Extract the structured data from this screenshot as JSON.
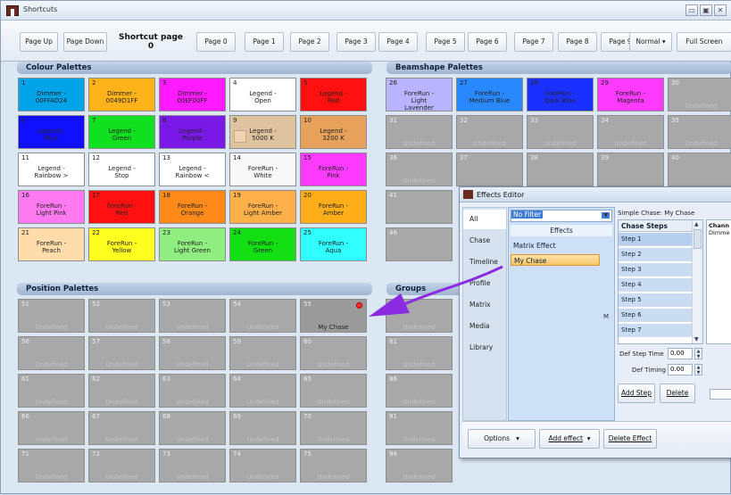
{
  "window": {
    "title": "Shortcuts"
  },
  "toolbar": {
    "page_up": "Page Up",
    "page_down": "Page Down",
    "shortcut_page": "Shortcut page 0",
    "pages": [
      "Page 0",
      "Page 1",
      "Page 2",
      "Page 3",
      "Page 4",
      "Page 5",
      "Page 6",
      "Page 7",
      "Page 8",
      "Page 9"
    ],
    "normal": "Normal",
    "full_screen": "Full Screen"
  },
  "panels": {
    "colour": "Colour Palettes",
    "beamshape": "Beamshape Palettes",
    "position": "Position Palettes",
    "groups": "Groups"
  },
  "colour_cells": [
    {
      "num": "1",
      "label": "Dimmer -\n00FFAD24",
      "color": "#00a2e8"
    },
    {
      "num": "2",
      "label": "Dimmer -\n0049D1FF",
      "color": "#ffb31a"
    },
    {
      "num": "3",
      "label": "Dimmer -\n00EF00FF",
      "color": "#ff1aff"
    },
    {
      "num": "4",
      "label": "Legend -\nOpen",
      "color": "#ffffff"
    },
    {
      "num": "5",
      "label": "Legend -\nRed",
      "color": "#ff1010"
    },
    {
      "num": "6",
      "label": "Legend -\nBlue",
      "color": "#1010ff"
    },
    {
      "num": "7",
      "label": "Legend -\nGreen",
      "color": "#10e020"
    },
    {
      "num": "8",
      "label": "Legend -\nPurple",
      "color": "#7a18e8"
    },
    {
      "num": "9",
      "label": "Legend -\n5000 K",
      "color": "#dfc39f"
    },
    {
      "num": "10",
      "label": "Legend -\n3200 K",
      "color": "#e6a15b"
    },
    {
      "num": "11",
      "label": "Legend -\nRainbow >",
      "color": "#ffffff"
    },
    {
      "num": "12",
      "label": "Legend -\nStop",
      "color": "#ffffff"
    },
    {
      "num": "13",
      "label": "Legend -\nRainbow <",
      "color": "#ffffff"
    },
    {
      "num": "14",
      "label": "ForeRun -\nWhite",
      "color": "#f8f8f8"
    },
    {
      "num": "15",
      "label": "ForeRun -\nPink",
      "color": "#ff3aff"
    },
    {
      "num": "16",
      "label": "ForeRun -\nLight Pink",
      "color": "#ff7af0"
    },
    {
      "num": "17",
      "label": "ForeRun -\nRed",
      "color": "#ff1010"
    },
    {
      "num": "18",
      "label": "ForeRun -\nOrange",
      "color": "#ff8a1a"
    },
    {
      "num": "19",
      "label": "ForeRun -\nLight Amber",
      "color": "#ffb04a"
    },
    {
      "num": "20",
      "label": "ForeRun -\nAmber",
      "color": "#ffae1a"
    },
    {
      "num": "21",
      "label": "ForeRun -\nPeach",
      "color": "#ffdcaa"
    },
    {
      "num": "22",
      "label": "ForeRun -\nYellow",
      "color": "#ffff20"
    },
    {
      "num": "23",
      "label": "ForeRun -\nLight Green",
      "color": "#90ee80"
    },
    {
      "num": "24",
      "label": "ForeRun -\nGreen",
      "color": "#12e012"
    },
    {
      "num": "25",
      "label": "ForeRun -\nAqua",
      "color": "#30ffff"
    }
  ],
  "beam_cells": [
    {
      "num": "26",
      "label": "ForeRun -\nLight\nLavender",
      "color": "#b8b4ff"
    },
    {
      "num": "27",
      "label": "ForeRun -\nMedium Blue",
      "color": "#2a88ff"
    },
    {
      "num": "28",
      "label": "ForeRun -\nDark Blue",
      "color": "#1a30ff"
    },
    {
      "num": "29",
      "label": "ForeRun -\nMagenta",
      "color": "#ff3aff"
    },
    {
      "num": "30",
      "label": "Undefined",
      "color": ""
    },
    {
      "num": "31",
      "label": "Undefined",
      "color": ""
    },
    {
      "num": "32",
      "label": "Undefined",
      "color": ""
    },
    {
      "num": "33",
      "label": "Undefined",
      "color": ""
    },
    {
      "num": "34",
      "label": "Undefined",
      "color": ""
    },
    {
      "num": "35",
      "label": "Undefined",
      "color": ""
    },
    {
      "num": "36",
      "label": "Undefined",
      "color": ""
    },
    {
      "num": "37",
      "label": "",
      "color": ""
    },
    {
      "num": "38",
      "label": "",
      "color": ""
    },
    {
      "num": "39",
      "label": "",
      "color": ""
    },
    {
      "num": "40",
      "label": "",
      "color": ""
    },
    {
      "num": "41",
      "label": "",
      "color": ""
    },
    {
      "num": "46",
      "label": "",
      "color": ""
    }
  ],
  "position_cells": [
    {
      "num": "51",
      "label": "Undefined"
    },
    {
      "num": "52",
      "label": "Undefined"
    },
    {
      "num": "53",
      "label": "Undefined"
    },
    {
      "num": "54",
      "label": "Undefined"
    },
    {
      "num": "55",
      "label": "My Chase",
      "dot": true
    },
    {
      "num": "56",
      "label": "Undefined"
    },
    {
      "num": "57",
      "label": "Undefined"
    },
    {
      "num": "58",
      "label": "Undefined"
    },
    {
      "num": "59",
      "label": "Undefined"
    },
    {
      "num": "60",
      "label": "Undefined"
    },
    {
      "num": "61",
      "label": "Undefined"
    },
    {
      "num": "62",
      "label": "Undefined"
    },
    {
      "num": "63",
      "label": "Undefined"
    },
    {
      "num": "64",
      "label": "Undefined"
    },
    {
      "num": "65",
      "label": "Undefined"
    },
    {
      "num": "66",
      "label": "Undefined"
    },
    {
      "num": "67",
      "label": "Undefined"
    },
    {
      "num": "68",
      "label": "Undefined"
    },
    {
      "num": "69",
      "label": "Undefined"
    },
    {
      "num": "70",
      "label": "Undefined"
    },
    {
      "num": "71",
      "label": "Undefined"
    },
    {
      "num": "72",
      "label": "Undefined"
    },
    {
      "num": "73",
      "label": "Undefined"
    },
    {
      "num": "74",
      "label": "Undefined"
    },
    {
      "num": "75",
      "label": "Undefined"
    }
  ],
  "group_cells": [
    {
      "num": "",
      "label": "Undefined"
    },
    {
      "num": "81",
      "label": "Undefined"
    },
    {
      "num": "86",
      "label": "Undefined"
    },
    {
      "num": "91",
      "label": "Undefined"
    },
    {
      "num": "96",
      "label": "Undefined"
    }
  ],
  "editor": {
    "title": "Effects Editor",
    "tabs": [
      "All",
      "Chase",
      "Timeline",
      "Profile",
      "Matrix",
      "Media",
      "Library"
    ],
    "filter": "No Filter",
    "effects_header": "Effects",
    "effects": [
      "Matrix Effect",
      "My Chase"
    ],
    "side_letter": "M",
    "simple_chase": "Simple Chase: My Chase",
    "chase_steps_header": "Chase Steps",
    "steps": [
      "Step 1",
      "Step 2",
      "Step 3",
      "Step 4",
      "Step 5",
      "Step 6",
      "Step 7"
    ],
    "channel_header": "Chann",
    "channel_sub": "Dimme",
    "def_step_time_label": "Def Step Time",
    "def_step_time": "0.00",
    "def_timing_label": "Def Timing",
    "def_timing": "0.00",
    "add_step": "Add Step",
    "delete": "Delete",
    "options": "Options",
    "add_effect": "Add effect",
    "delete_effect": "Delete Effect"
  },
  "colors": {
    "arrow": "#8a2be2",
    "undefined_cell": "#a8a8a8"
  }
}
